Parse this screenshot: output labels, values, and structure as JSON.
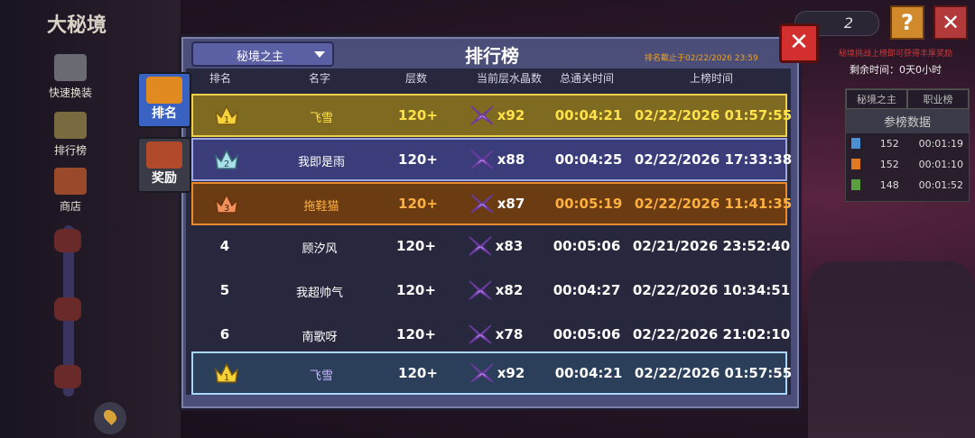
{
  "game": {
    "area_title": "大秘境",
    "side_nav": [
      {
        "label": "快速换装"
      },
      {
        "label": "排行榜"
      },
      {
        "label": "商店"
      }
    ],
    "currency_count": "2",
    "help_label": "?",
    "close_label": "✕",
    "event_note": "秘境挑战上榜即可获得丰厚奖励",
    "remaining_time": "剩余时间：0天0小时",
    "ref_panel": {
      "tabs": [
        "秘境之主",
        "职业榜"
      ],
      "header": "参榜数据",
      "rows": [
        {
          "gem_color": "#4a90d0",
          "count": "152",
          "time": "00:01:19"
        },
        {
          "gem_color": "#e07a20",
          "count": "152",
          "time": "00:01:10"
        },
        {
          "gem_color": "#5aa040",
          "count": "148",
          "time": "00:01:52"
        }
      ]
    }
  },
  "leaderboard": {
    "title": "排行榜",
    "dropdown": "秘境之主",
    "deadline": "排名截止于02/22/2026 23:59",
    "close_label": "✕",
    "side_tabs": [
      {
        "label": "排名",
        "active": true
      },
      {
        "label": "奖励",
        "active": false
      }
    ],
    "columns": {
      "rank": "排名",
      "name": "名字",
      "floor": "层数",
      "crystals": "当前层水晶数",
      "total_time": "总通关时间",
      "listed_time": "上榜时间"
    },
    "rows": [
      {
        "rank": "1",
        "name": "飞雪",
        "floor": "120+",
        "crystals": "x92",
        "total_time": "00:04:21",
        "listed_time": "02/22/2026 01:57:55",
        "tier": "gold"
      },
      {
        "rank": "2",
        "name": "我即是雨",
        "floor": "120+",
        "crystals": "x88",
        "total_time": "00:04:25",
        "listed_time": "02/22/2026 17:33:38",
        "tier": "silver"
      },
      {
        "rank": "3",
        "name": "拖鞋猫",
        "floor": "120+",
        "crystals": "x87",
        "total_time": "00:05:19",
        "listed_time": "02/22/2026 11:41:35",
        "tier": "bronze"
      },
      {
        "rank": "4",
        "name": "顾汐风",
        "floor": "120+",
        "crystals": "x83",
        "total_time": "00:05:06",
        "listed_time": "02/21/2026 23:52:40",
        "tier": "none"
      },
      {
        "rank": "5",
        "name": "我超帅气",
        "floor": "120+",
        "crystals": "x82",
        "total_time": "00:04:27",
        "listed_time": "02/22/2026 10:34:51",
        "tier": "none"
      },
      {
        "rank": "6",
        "name": "南歌呀",
        "floor": "120+",
        "crystals": "x78",
        "total_time": "00:05:06",
        "listed_time": "02/22/2026 21:02:10",
        "tier": "none"
      }
    ],
    "self_row": {
      "rank": "1",
      "name": "飞雪",
      "floor": "120+",
      "crystals": "x92",
      "total_time": "00:04:21",
      "listed_time": "02/22/2026 01:57:55"
    }
  }
}
